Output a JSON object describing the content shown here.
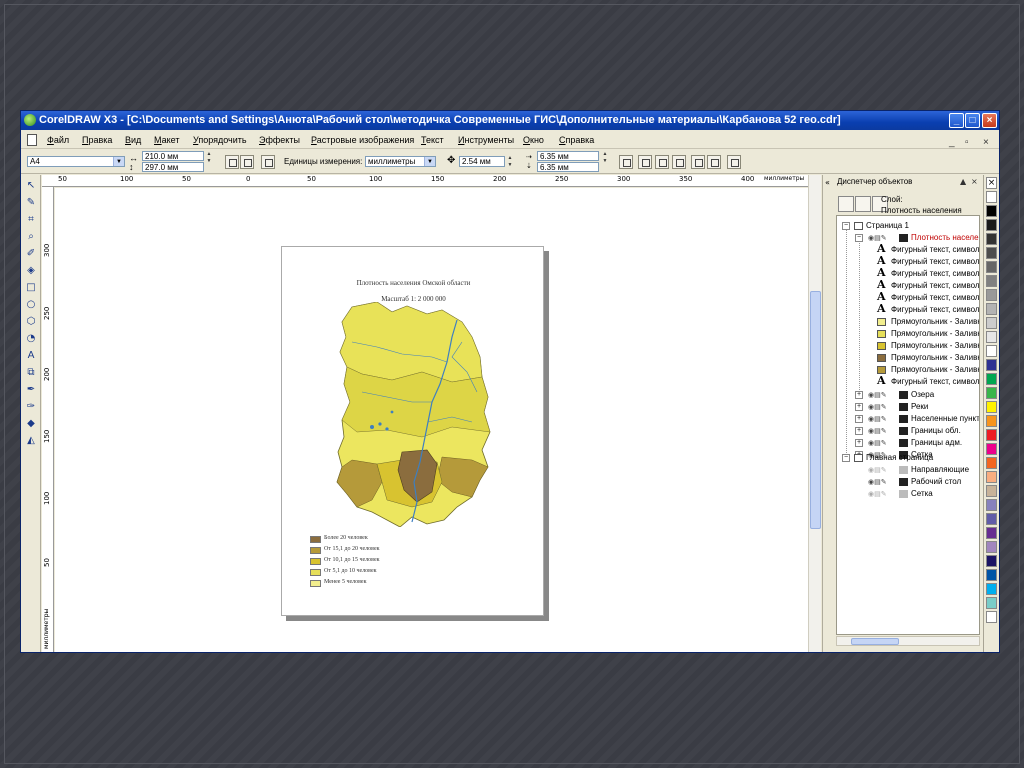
{
  "window": {
    "title": "CorelDRAW X3 - [C:\\Documents and Settings\\Анюта\\Рабочий стол\\методичка Современные ГИС\\Дополнительные материалы\\Карбанова 52 гео.cdr]"
  },
  "menu": {
    "items": [
      "Файл",
      "Правка",
      "Вид",
      "Макет",
      "Упорядочить",
      "Эффекты",
      "Растровые изображения",
      "Текст",
      "Инструменты",
      "Окно",
      "Справка"
    ]
  },
  "propbar": {
    "page_size": "A4",
    "width": "210.0 мм",
    "height": "297.0 мм",
    "units_label": "Единицы измерения:",
    "units_value": "миллиметры",
    "nudge": "2.54 мм",
    "dup_x": "6.35 мм",
    "dup_y": "6.35 мм"
  },
  "ruler": {
    "h_labels": [
      "50",
      "100",
      "50",
      "0",
      "50",
      "100",
      "150",
      "200",
      "250",
      "300",
      "350",
      "400"
    ],
    "h_unit": "миллиметры",
    "v_labels": [
      "300",
      "250",
      "200",
      "150",
      "100",
      "50"
    ],
    "v_unit": "миллиметры"
  },
  "map": {
    "title": "Плотность населения Омской области",
    "scale": "Масштаб 1: 2 000 000",
    "legend": [
      {
        "label": "Более 20 человек",
        "color": "#8b6d3e"
      },
      {
        "label": "От 15,1 до 20 человек",
        "color": "#b59a3a"
      },
      {
        "label": "От 10,1 до 15 человек",
        "color": "#d8c330"
      },
      {
        "label": "От 5,1 до 10 человек",
        "color": "#e6df5a"
      },
      {
        "label": "Менее 5 человек",
        "color": "#f2ee8e"
      }
    ]
  },
  "docker": {
    "title": "Диспетчер объектов",
    "layer_label": "Слой:",
    "layer_name": "Плотность населения",
    "page1": "Страница 1",
    "active_layer": "Плотность населен",
    "objects": [
      {
        "label": "Фигурный текст, символо",
        "kind": "text"
      },
      {
        "label": "Фигурный текст, символо",
        "kind": "text"
      },
      {
        "label": "Фигурный текст, символо",
        "kind": "text"
      },
      {
        "label": "Фигурный текст, символо",
        "kind": "text"
      },
      {
        "label": "Фигурный текст, символо",
        "kind": "text"
      },
      {
        "label": "Фигурный текст, символо",
        "kind": "text"
      },
      {
        "label": "Прямоугольник - Заливка",
        "kind": "rect",
        "color": "#f2ee8e"
      },
      {
        "label": "Прямоугольник - Заливка",
        "kind": "rect",
        "color": "#e6df5a"
      },
      {
        "label": "Прямоугольник - Заливка",
        "kind": "rect",
        "color": "#d8c330"
      },
      {
        "label": "Прямоугольник - Заливка",
        "kind": "rect",
        "color": "#8b6d3e"
      },
      {
        "label": "Прямоугольник - Заливка",
        "kind": "rect",
        "color": "#b59a3a"
      },
      {
        "label": "Фигурный текст, символо",
        "kind": "text"
      }
    ],
    "layers": [
      "Озера",
      "Реки",
      "Населенные пункть",
      "Границы обл.",
      "Границы адм.",
      "Сетка"
    ],
    "master_page": "Главная страница",
    "master_layers": [
      "Направляющие",
      "Рабочий стол",
      "Сетка"
    ]
  },
  "palette": [
    "#ffffff",
    "#000000",
    "#1a1a1a",
    "#333333",
    "#4d4d4d",
    "#666666",
    "#808080",
    "#999999",
    "#b3b3b3",
    "#cccccc",
    "#e6e6e6",
    "#ffffff",
    "#2e3192",
    "#00a651",
    "#39b54a",
    "#fff200",
    "#f7941d",
    "#ed1c24",
    "#ec008c",
    "#f26522",
    "#f9ad81",
    "#c7b299",
    "#8781bd",
    "#605ca8",
    "#662d91",
    "#a186be",
    "#1b1464",
    "#0054a6",
    "#00aeef",
    "#7accc8",
    "#ffffff"
  ]
}
